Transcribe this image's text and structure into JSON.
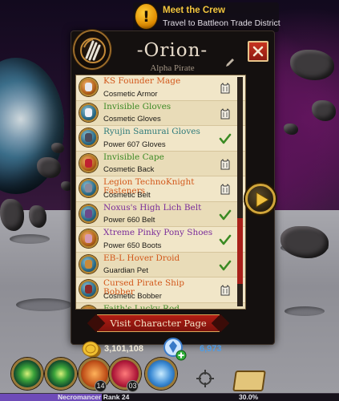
{
  "quest": {
    "title": "Meet the Crew",
    "subtitle": "Travel to Battleon Trade District",
    "icon": "exclamation-icon"
  },
  "character": {
    "name": "-Orion-",
    "title": "Alpha Pirate"
  },
  "items": [
    {
      "name": "KS Founder Mage",
      "type": "Cosmetic Armor",
      "color": "#d2581b",
      "status": "cosmetic"
    },
    {
      "name": "Invisible Gloves",
      "type": "Cosmetic Gloves",
      "color": "#3d8a25",
      "status": "cosmetic"
    },
    {
      "name": "Ryujin Samurai Gloves",
      "type": "Power 607 Gloves",
      "color": "#2d7a7a",
      "status": "equipped"
    },
    {
      "name": "Invisible Cape",
      "type": "Cosmetic Back",
      "color": "#3d8a25",
      "status": "cosmetic"
    },
    {
      "name": "Legion TechnoKnight Fasteners",
      "type": "Cosmetic Belt",
      "color": "#d2581b",
      "status": "cosmetic"
    },
    {
      "name": "Noxus's High Lich Belt",
      "type": "Power 660 Belt",
      "color": "#7a2c9a",
      "status": "equipped"
    },
    {
      "name": "Xtreme Pinky Pony Shoes",
      "type": "Power 650 Boots",
      "color": "#7a2c9a",
      "status": "equipped"
    },
    {
      "name": "EB-L Hover Droid",
      "type": "Guardian Pet",
      "color": "#d2581b",
      "status": "equipped"
    },
    {
      "name": "Cursed Pirate Ship Bobber",
      "type": "Cosmetic Bobber",
      "color": "#d2581b",
      "status": "cosmetic"
    },
    {
      "name": "Faith's Lucky Rod",
      "type": "",
      "color": "#3d8a25",
      "status": "equipped"
    }
  ],
  "actions": {
    "visit_label": "Visit Character Page"
  },
  "currency": {
    "gold": "3,101,108",
    "gems": "6,973"
  },
  "hotbar": {
    "cooldown_1": "14",
    "cooldown_2": "03"
  },
  "xp": {
    "rank_label": "Necromancer Rank 24",
    "percent_label": "30.0%",
    "fraction": 0.3
  },
  "colors": {
    "accent_gold": "#d2a63a",
    "close_red": "#c7331f",
    "gem_blue": "#4f9de6"
  }
}
